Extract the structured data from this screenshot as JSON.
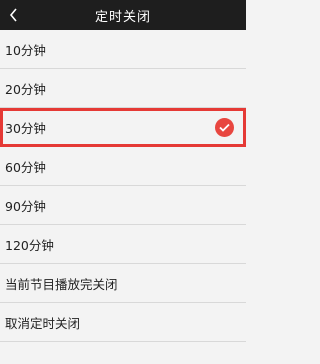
{
  "header": {
    "title": "定时关闭",
    "back_icon": "chevron-left-icon"
  },
  "options": [
    {
      "label": "10分钟",
      "selected": false
    },
    {
      "label": "20分钟",
      "selected": false
    },
    {
      "label": "30分钟",
      "selected": true
    },
    {
      "label": "60分钟",
      "selected": false
    },
    {
      "label": "90分钟",
      "selected": false
    },
    {
      "label": "120分钟",
      "selected": false
    },
    {
      "label": "当前节目播放完关闭",
      "selected": false
    },
    {
      "label": "取消定时关闭",
      "selected": false
    }
  ],
  "colors": {
    "header_bg": "#1e1e1e",
    "accent": "#e53935",
    "list_bg": "#f3f3f3"
  }
}
